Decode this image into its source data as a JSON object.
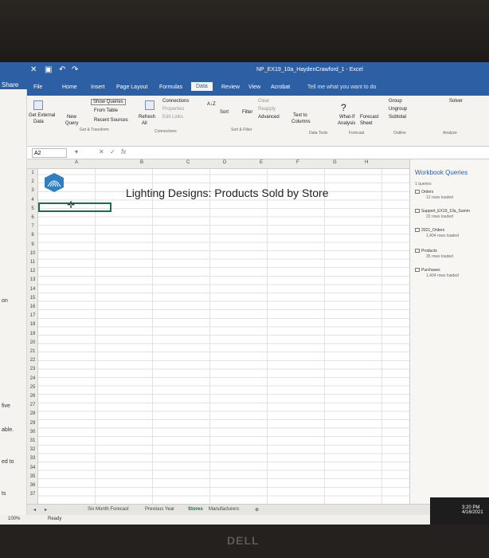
{
  "window": {
    "filename": "NP_EX19_10a_HaydenCrawford_1 - Excel",
    "tell_me": "Tell me what you want to do"
  },
  "left_panel": {
    "share": "Share",
    "texts": [
      "on",
      "five",
      "able.",
      "ed to",
      "ts"
    ]
  },
  "ribbon": {
    "tabs": [
      {
        "label": "File"
      },
      {
        "label": "Home"
      },
      {
        "label": "Insert"
      },
      {
        "label": "Page Layout"
      },
      {
        "label": "Formulas"
      },
      {
        "label": "Data"
      },
      {
        "label": "Review"
      },
      {
        "label": "View"
      },
      {
        "label": "Acrobat"
      }
    ],
    "get_external": "Get External",
    "data": "Data",
    "new": "New",
    "query": "Query",
    "show_queries": "Show Queries",
    "from_table": "From Table",
    "recent_sources": "Recent Sources",
    "get_transform": "Get & Transform",
    "connections": "Connections",
    "properties": "Properties",
    "edit_links": "Edit Links",
    "refresh": "Refresh",
    "all": "All",
    "connections_group": "Connections",
    "sort": "Sort",
    "filter": "Filter",
    "clear": "Clear",
    "reapply": "Reapply",
    "advanced": "Advanced",
    "sort_filter": "Sort & Filter",
    "text_to": "Text to",
    "columns": "Columns",
    "data_tools": "Data Tools",
    "what_if": "What-If",
    "analysis": "Analysis",
    "forecast": "Forecast",
    "sheet": "Sheet",
    "forecast_group": "Forecast",
    "group": "Group",
    "ungroup": "Ungroup",
    "subtotal": "Subtotal",
    "outline": "Outline",
    "solver": "Solver",
    "analyze": "Analyze"
  },
  "formula_bar": {
    "name_box": "A2",
    "fx": "fx"
  },
  "grid": {
    "columns": [
      "A",
      "B",
      "C",
      "D",
      "E",
      "F",
      "G",
      "H"
    ],
    "rows": [
      "1",
      "2",
      "3",
      "4",
      "5",
      "6",
      "7",
      "8",
      "9",
      "10",
      "11",
      "12",
      "13",
      "14",
      "15",
      "16",
      "17",
      "18",
      "19",
      "20",
      "21",
      "22",
      "23",
      "24",
      "25",
      "26",
      "27",
      "28",
      "29",
      "30",
      "31",
      "32",
      "33",
      "34",
      "35",
      "36",
      "37"
    ]
  },
  "sheet": {
    "title": "Lighting Designs: Products Sold by Store"
  },
  "queries_pane": {
    "title": "Workbook Queries",
    "subtitle": "1 queries",
    "items": [
      {
        "name": "Orders",
        "rows": "12 rows loaded"
      },
      {
        "name": "Support_EX19_10a_Summ",
        "rows": "22 rows loaded"
      },
      {
        "name": "2021_Orders",
        "rows": "1,404 rows loaded"
      },
      {
        "name": "Products",
        "rows": "35 rows loaded"
      },
      {
        "name": "Purchases",
        "rows": "1,404 rows loaded"
      }
    ]
  },
  "sheet_tabs": [
    {
      "label": "Six Month Forecast"
    },
    {
      "label": "Previous Year"
    },
    {
      "label": "Stores"
    },
    {
      "label": "Manufacturers"
    }
  ],
  "status": {
    "ready": "Ready",
    "zoom": "100%",
    "time": "3:20 PM",
    "date": "4/16/2021"
  },
  "brand": "DELL"
}
